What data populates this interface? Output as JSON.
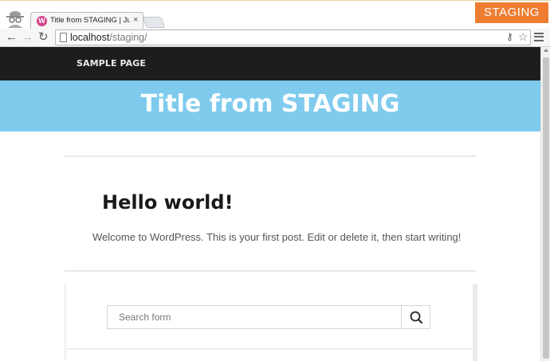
{
  "browser": {
    "tab_title": "Title from STAGING | Just an",
    "tab_favicon": "W",
    "tab_close": "×",
    "url_host": "localhost",
    "url_path": "/staging/",
    "environment_badge": "STAGING",
    "icons": {
      "back": "←",
      "forward": "→",
      "reload": "↻",
      "key": "⚷",
      "star": "☆"
    }
  },
  "site": {
    "nav_link": "SAMPLE PAGE",
    "title": "Title from STAGING"
  },
  "post": {
    "title": "Hello world!",
    "excerpt": "Welcome to WordPress. This is your first post. Edit or delete it, then start writing!"
  },
  "search": {
    "placeholder": "Search form",
    "value": ""
  },
  "colors": {
    "nav_bg": "#1d1d1d",
    "hero_bg": "#7fcbee",
    "badge_bg": "#ee7d31"
  }
}
